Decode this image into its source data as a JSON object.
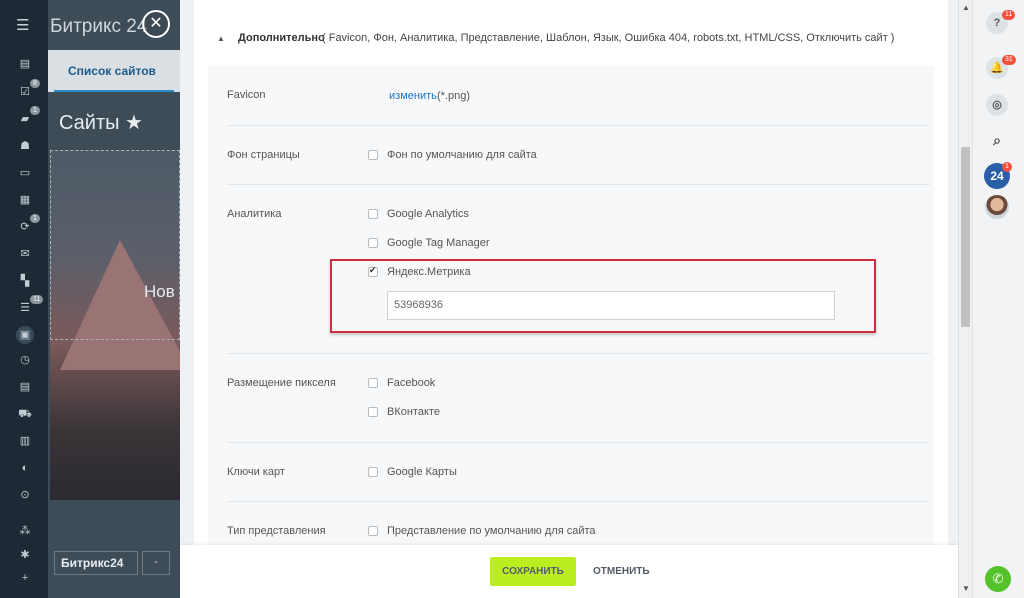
{
  "app": {
    "logo": "Битрикс 24",
    "close_glyph": "✕"
  },
  "leftbar": {
    "counters": [
      "8",
      "1",
      "1",
      "11"
    ]
  },
  "behind": {
    "tab_label": "Список сайтов",
    "page_title": "Сайты ★",
    "new_card_text": "Нов",
    "footer_logo": "Битрикс24",
    "footer_btn": "-"
  },
  "section": {
    "title": "Дополнительно",
    "details": "( Favicon,  Фон,  Аналитика,  Представление,  Шаблон,  Язык,  Ошибка 404,  robots.txt,  HTML/CSS,  Отключить сайт )"
  },
  "fields": {
    "favicon": {
      "label": "Favicon",
      "link": "изменить",
      "hint": "(*.png)"
    },
    "background": {
      "label": "Фон страницы",
      "option": "Фон по умолчанию для сайта",
      "checked": false
    },
    "analytics": {
      "label": "Аналитика",
      "options": [
        {
          "label": "Google Analytics",
          "checked": false
        },
        {
          "label": "Google Tag Manager",
          "checked": false
        },
        {
          "label": "Яндекс.Метрика",
          "checked": true
        }
      ],
      "metrika_value": "53968936"
    },
    "pixel": {
      "label": "Размещение пикселя",
      "options": [
        {
          "label": "Facebook",
          "checked": false
        },
        {
          "label": "ВКонтакте",
          "checked": false
        }
      ]
    },
    "map_keys": {
      "label": "Ключи карт",
      "option": "Google Карты",
      "checked": false
    },
    "view_type": {
      "label": "Тип представления",
      "option": "Представление по умолчанию для сайта",
      "checked": false
    }
  },
  "actions": {
    "save": "СОХРАНИТЬ",
    "cancel": "ОТМЕНИТЬ"
  },
  "rightbar": {
    "help_badge": "11",
    "notifications_badge": "31",
    "b24_label": "24",
    "b24_badge": "1"
  },
  "colors": {
    "accent_link": "#1a73c6",
    "save_button": "#bbed21",
    "highlight_border": "#c7313f",
    "badge": "#f0523f"
  }
}
